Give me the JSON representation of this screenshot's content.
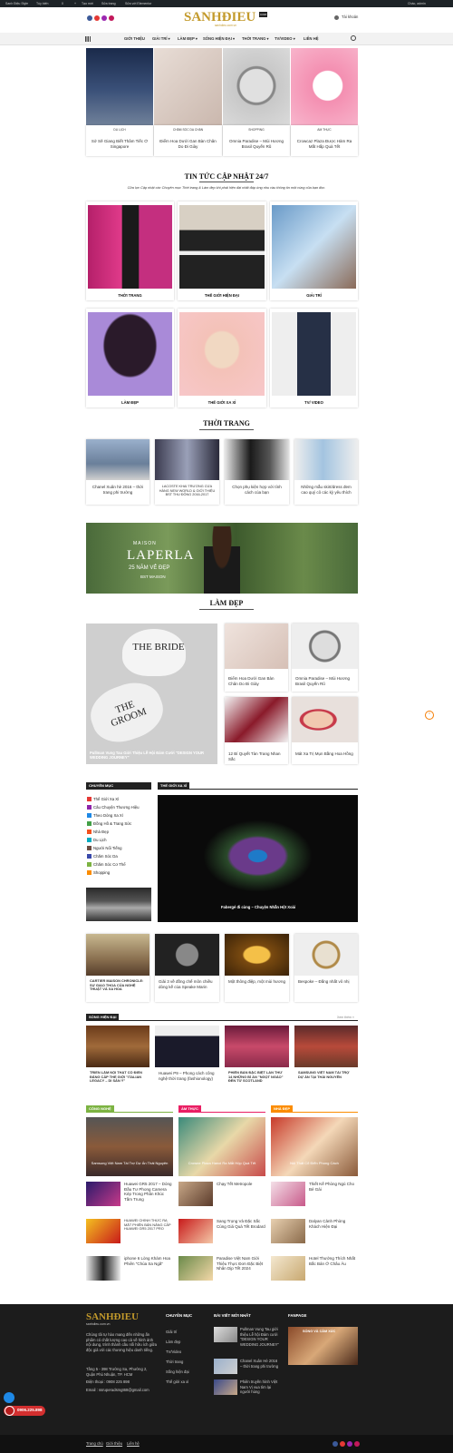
{
  "admin_bar": {
    "items": [
      "Sanh Điệu Style",
      "Tùy biến",
      "0",
      "+",
      "Tạo mới",
      "Sửa trang",
      "Sửa với Elementor"
    ],
    "user": "Chào, admin"
  },
  "header": {
    "logo": "SANHĐIEU",
    "logo_badge": "COM",
    "tagline": "sanhdieu.com.vn",
    "login": "Tài khoản"
  },
  "nav": {
    "items": [
      "GIỚI THIỆU",
      "GIẢI TRÍ ▾",
      "LÀM ĐẸP ▾",
      "SỐNG HIỆN ĐẠI ▾",
      "THỜI TRANG ▾",
      "TV/VIDEO ▾",
      "LIÊN HỆ"
    ]
  },
  "slider": [
    {
      "cat": "DU LỊCH",
      "title": "Sở Sẽ Giang Biết Thâm Tiếc Ở Singapore"
    },
    {
      "cat": "CHĂM SÓC DA CHÂN",
      "title": "Điểm Hoa Dưới Gan Bàn Chân Do Đi Giày"
    },
    {
      "cat": "SHOPPING",
      "title": "Omnia Paradise – Mùi Hương Brasil Quyến Rũ"
    },
    {
      "cat": "ẨM THỰC",
      "title": "Crowcaz Plaza Được Hàm Ra Mắt Hấp Quà Tết"
    }
  ],
  "updates": {
    "title": "TIN TỨC CẬP NHẬT 24/7",
    "subtitle": "Cửa lực Cập nhật các Chuyên mục Thời trang & Làm đẹp khi phái hiện đại nhất đáp ứng nhu cầu thông tin một cùng của bạn đọc.",
    "cats": [
      "THỜI TRANG",
      "THẾ GIỚI HIỆN ĐẠI",
      "GIẢI TRÍ",
      "LÀM ĐẸP",
      "THẾ GIỚI XA XỈ",
      "TV/ VIDEO"
    ]
  },
  "fashion": {
    "title": "THỜI TRANG",
    "items": [
      "Chanel Xuân hè 2016 – thời trang phi trường",
      "LACOSTE KHAI TRƯƠNG CỬA HÀNG NEW WORLD & GIỚI THIỆU BST THU ĐÔNG 2016-2017",
      "Chọn phụ kiện hợp với tính cách của bạn",
      "Những mẫu skirt/dress đem cao quý cô các kỳ yêu thích"
    ]
  },
  "banner": {
    "brand": "MAISON",
    "name": "LAPERLA",
    "line": "25 NĂM VẺ ĐẸP",
    "line2": "BST MAISON"
  },
  "beauty": {
    "title": "LÀM ĐẸP",
    "big": "Pullman Vung Tau Giới Thiệu Lễ Hội Đám Cưới \"DESIGN YOUR WEDDING JOURNEY\"",
    "bride": "THE BRIDE",
    "groom": "THE GROOM",
    "items": [
      "Điểm Hoa Dưới Gan Bàn Chân Do Đi Giày",
      "Omnia Paradise – Mùi Hương Brasil Quyến Rũ",
      "12 Bí Quyết Tàn Trang Nhan Sắc",
      "Mát Xa Trị Mụn Bằng Hoa Hồng"
    ]
  },
  "sidebar": {
    "title": "CHUYÊN MỤC",
    "items": [
      "Thế Giới Xa Xỉ",
      "Câu Chuyện Thương Hiệu",
      "Theo Dòng Xa Xỉ",
      "Đồng Hồ & Trang Sức",
      "Nhà Đẹp",
      "Du Lịch",
      "Người Nổi Tiếng",
      "Chăm Sóc Da",
      "Chăm Sóc Cơ Thể",
      "Shopping"
    ],
    "colors": [
      "#e53935",
      "#8e24aa",
      "#1e88e5",
      "#43a047",
      "#f4511e",
      "#00acc1",
      "#6d4c41",
      "#3949ab",
      "#7cb342",
      "#fb8c00"
    ]
  },
  "luxury": {
    "title": "THẾ GIỚI XA XỈ",
    "caption": "Fabergé đi cùng – Chuyện Nhẫn Hột Xoài",
    "items": [
      "CARTIER MAISON CHRONICLE: SỰ GIAO THOA CỦA NGHỆ THUẬT VÀ XA HOA",
      "Giải 3 về đồng chế môn chiều dòng kế của Speake Marin",
      "Một thông điệp, một mùi hương",
      "Bespoke – Đẳng nhất vô nhị"
    ]
  },
  "modern": {
    "title": "SỐNG HIỆN ĐẠI",
    "more": "Xem thêm »",
    "items": [
      "TRIỂN LÃM NỘI THẤT CÓ ĐIỂN ĐẲNG CẤP THẾ GIỚI \"ITALIAN LEGACY – DI SẢN Ý\"",
      "Huawei P9 – Phong cách công nghệ thời trang (fashionology)",
      "PHIÊN BẢN ĐẶC BIỆT LẦN THỨ 14 NHỮNG BÍ ẨN \"NGỌT NGÀO\" ĐẾN TỪ SCOTLAND",
      "SAMSUNG VIỆT NAM TÀI TRỢ DỰ ÁN TẠI THÁI NGUYÊN"
    ]
  },
  "cols": [
    {
      "title": "CÔNG NGHỆ",
      "color": "#7cb342",
      "big": "Samsung Việt Nam Tài Trợ Dự Án Thái Nguyên",
      "items": [
        "Huawei GR5 2017 – Dòng Đầu Tư Phong Camera Kép Trong Phân Khúc Tầm Trung",
        "HUAWEI CHÍNH THỨC RA MẮT PHIÊN BẢN NÂNG CẤP HUAWEI GR5 2017 PRO",
        "iphone 6 Lòng Khám Hoa Phiên \"Chúa Sa Ngã\""
      ]
    },
    {
      "title": "ẨM THỰC",
      "color": "#e91e63",
      "big": "Crowne Plaza Hanoi Ra Mắt Hộp Quà Tết",
      "items": [
        "Chạy Tết Metropole",
        "Sang Trọng Và Đặc Sắc Cùng Giá Quá Tết Brodard",
        "Paradise Việt Nam Giới Thiệu Thực Đơn Đặc Biệt Nhân Dịp Tết 2024"
      ]
    },
    {
      "title": "NHÀ ĐẸP",
      "color": "#fb8c00",
      "big": "Nội Thất Cổ Điển Phong Cách",
      "items": [
        "Thiết Kế Phòng Ngủ Cho Bé Gái",
        "Dalyan Cảnh Phòng Khách Hiện Đại",
        "Hotel Thưởng Thích Nhất Bắc Bán Ở Châu Âu"
      ]
    }
  ],
  "footer": {
    "logo": "SANHĐIEU",
    "logo_sub": "sanhdieu.com.vn",
    "about": "Chúng tôi tự hào mang đến những ấn phẩm có chất lượng cao cả về hình ảnh nội dung, trình thành cầu nối hữu ích giữa độc giả với các thương hiệu danh tiếng.",
    "address": "Tầng 5 - 398 Trường Sa, Phường 2, Quận Phú Nhuận, TP. HCM",
    "phone": "Điện thoại : 0908 225 898",
    "email": "Email : ssruperadsmgt68@gmail.com",
    "cat_title": "CHUYÊN MỤC",
    "cats": [
      "Giải trí",
      "Làm đẹp",
      "TV/Video",
      "Thời trang",
      "Sống hiện đại",
      "Thế giới xa xỉ"
    ],
    "new_title": "BÀI VIẾT MỚI NHẤT",
    "news": [
      "Pullman Vung Tau giới thiệu Lễ hội Đám cưới \"DESIGN YOUR WEDDING JOURNEY\"",
      "Chanel Xuân Hè 2016 – thời trang phi trường",
      "Phiên truyền hình Việt Nam Vị vua tìm lại người hùng"
    ],
    "page_title": "FANPAGE",
    "page_name": "SỐNG VÀ CẢM XÚC",
    "links": [
      "Trang chủ",
      "Giới thiệu",
      "Liên hệ"
    ],
    "hotline": "0906.225.898"
  }
}
